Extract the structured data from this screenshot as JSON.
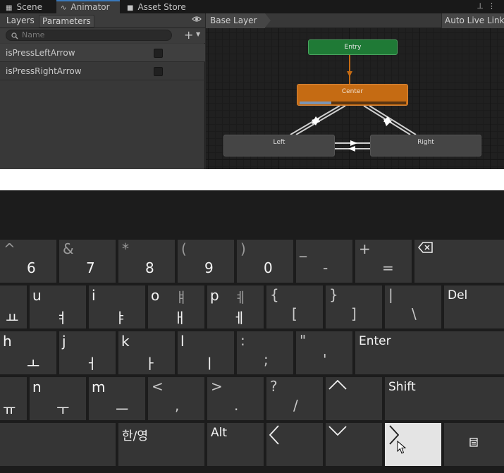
{
  "tabs": [
    {
      "label": "Scene",
      "icon": "scene-icon"
    },
    {
      "label": "Animator",
      "icon": "animator-icon"
    },
    {
      "label": "Asset Store",
      "icon": "asset-store-icon"
    }
  ],
  "left_panel": {
    "tabs": [
      "Layers",
      "Parameters"
    ],
    "search_placeholder": "Name",
    "parameters": [
      {
        "name": "isPressLeftArrow",
        "type": "bool",
        "checked": false
      },
      {
        "name": "isPressRightArrow",
        "type": "bool",
        "checked": false
      }
    ]
  },
  "graph": {
    "breadcrumb": "Base Layer",
    "auto_live_link": "Auto Live Link",
    "nodes": {
      "entry": "Entry",
      "center": "Center",
      "left": "Left",
      "right": "Right"
    },
    "center_progress": 0.3,
    "colors": {
      "entry": "#1f7a36",
      "default_state": "#c56b13",
      "state": "#454545",
      "grid": "#202020"
    }
  },
  "keyboard": {
    "rows": [
      [
        {
          "secondary": "^",
          "primary": "6"
        },
        {
          "secondary": "&",
          "primary": "7"
        },
        {
          "secondary": "*",
          "primary": "8"
        },
        {
          "secondary": "(",
          "primary": "9"
        },
        {
          "secondary": ")",
          "primary": "0"
        },
        {
          "secondary": "_",
          "primary": "-"
        },
        {
          "secondary": "+",
          "primary": "="
        },
        {
          "icon": "backspace-icon"
        }
      ],
      [
        {
          "korean": "ㅛ"
        },
        {
          "latin": "u",
          "korean": "ㅕ"
        },
        {
          "latin": "i",
          "korean": "ㅑ"
        },
        {
          "latin": "o",
          "secondary": "ㅒ",
          "korean": "ㅐ"
        },
        {
          "latin": "p",
          "secondary": "ㅖ",
          "korean": "ㅔ"
        },
        {
          "secondary": "{",
          "primary": "["
        },
        {
          "secondary": "}",
          "primary": "]"
        },
        {
          "secondary": "|",
          "primary": "\\"
        },
        {
          "label": "Del"
        }
      ],
      [
        {
          "latin": "h",
          "korean": "ㅗ"
        },
        {
          "latin": "j",
          "korean": "ㅓ"
        },
        {
          "latin": "k",
          "korean": "ㅏ"
        },
        {
          "latin": "l",
          "korean": "ㅣ"
        },
        {
          "secondary": ":",
          "primary": ";"
        },
        {
          "secondary": "\"",
          "primary": "'"
        },
        {
          "label": "Enter"
        }
      ],
      [
        {
          "korean": "ㅠ"
        },
        {
          "latin": "n",
          "korean": "ㅜ"
        },
        {
          "latin": "m",
          "korean": "ㅡ"
        },
        {
          "secondary": "<",
          "primary": ","
        },
        {
          "secondary": ">",
          "primary": "."
        },
        {
          "secondary": "?",
          "primary": "/"
        },
        {
          "icon": "arrow-up-icon"
        },
        {
          "label": "Shift"
        }
      ],
      [
        {
          "label": ""
        },
        {
          "label": "한/영"
        },
        {
          "label": "Alt"
        },
        {
          "icon": "arrow-left-icon"
        },
        {
          "icon": "arrow-down-icon"
        },
        {
          "icon": "arrow-right-icon"
        },
        {
          "icon": "menu-icon"
        }
      ]
    ],
    "colors": {
      "key": "#353535",
      "background": "#1c1c1c",
      "hover_key": "#e4e4e4"
    }
  }
}
